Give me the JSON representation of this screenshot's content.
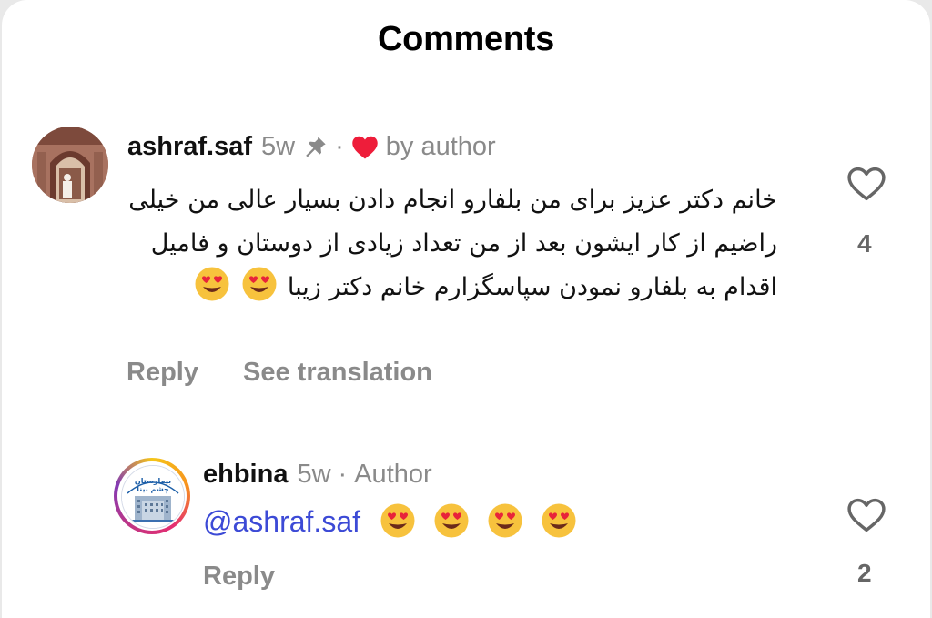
{
  "header": {
    "title": "Comments"
  },
  "comment1": {
    "username": "ashraf.saf",
    "time": "5w",
    "pinned_icon": "pin-icon",
    "liked_icon": "heart-filled-icon",
    "liked_by": "by author",
    "text": "خانم دکتر عزیز برای من بلفارو انجام دادن بسیار عالی من خیلی راضیم از کار ایشون بعد از من تعداد زیادی از دوستان و فامیل اقدام به بلفارو نمودن سپاسگزارم خانم دکتر زیبا",
    "emoji": "heart-eyes-emoji",
    "reply_label": "Reply",
    "translate_label": "See translation",
    "like_count": "4"
  },
  "comment2": {
    "username": "ehbina",
    "time": "5w",
    "separator": "·",
    "badge": "Author",
    "mention": "@ashraf.saf",
    "avatar_text_1": "بیمارستان",
    "avatar_text_2": "چشم بینا",
    "reply_label": "Reply",
    "like_count": "2"
  },
  "colors": {
    "liked_heart": "#ee1d3a",
    "mention": "#3c4ad6",
    "muted": "#8a8a8a",
    "avatar_ring": [
      "#f5c518",
      "#e52e71",
      "#833ab4"
    ]
  }
}
